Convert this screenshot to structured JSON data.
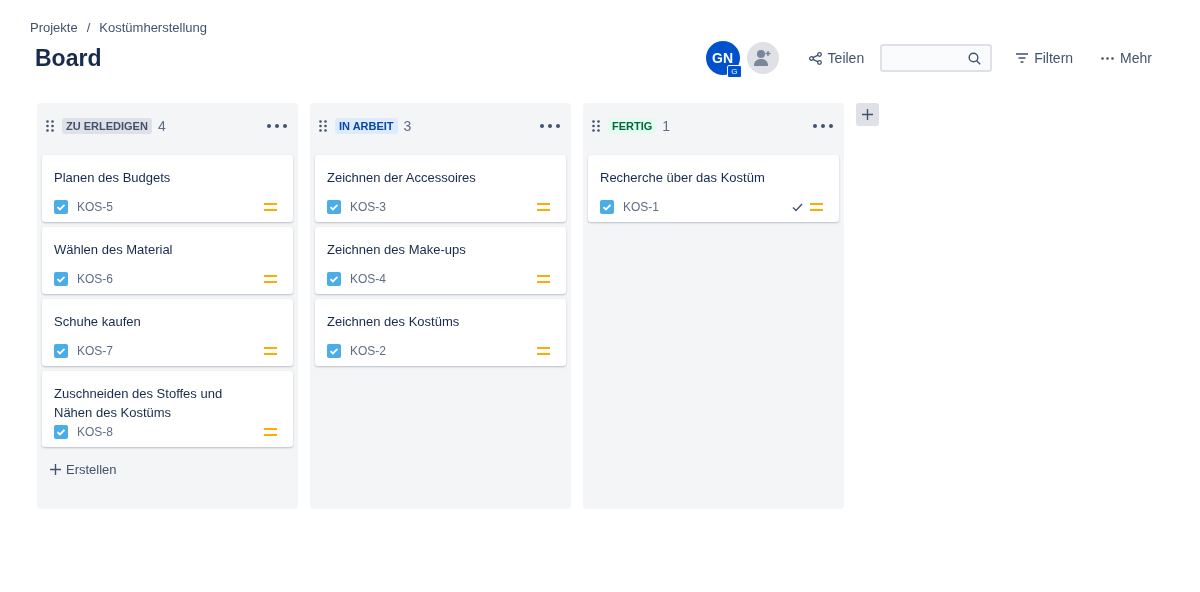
{
  "breadcrumbs": [
    "Projekte",
    "Kostümherstellung"
  ],
  "breadcrumb_separator": "/",
  "title": "Board",
  "avatar": {
    "initials": "GN",
    "badge": "G"
  },
  "share": "Teilen",
  "filter": "Filtern",
  "more": "Mehr",
  "columns": [
    {
      "status": "ZU ERLEDIGEN",
      "kind": "todo",
      "count": "4",
      "create": "Erstellen",
      "cards": [
        {
          "title": "Planen des Budgets",
          "key": "KOS-5",
          "done": false
        },
        {
          "title": "Wählen des Material",
          "key": "KOS-6",
          "done": false
        },
        {
          "title": "Schuhe kaufen",
          "key": "KOS-7",
          "done": false
        },
        {
          "title": "Zuschneiden des Stoffes und Nähen des Kostüms",
          "key": "KOS-8",
          "done": false
        }
      ]
    },
    {
      "status": "IN ARBEIT",
      "kind": "inprogress",
      "count": "3",
      "cards": [
        {
          "title": "Zeichnen der Accessoires",
          "key": "KOS-3",
          "done": false
        },
        {
          "title": "Zeichnen des Make-ups",
          "key": "KOS-4",
          "done": false
        },
        {
          "title": "Zeichnen des Kostüms",
          "key": "KOS-2",
          "done": false
        }
      ]
    },
    {
      "status": "FERTIG",
      "kind": "done",
      "count": "1",
      "cards": [
        {
          "title": "Recherche über das Kostüm",
          "key": "KOS-1",
          "done": true
        }
      ]
    }
  ]
}
